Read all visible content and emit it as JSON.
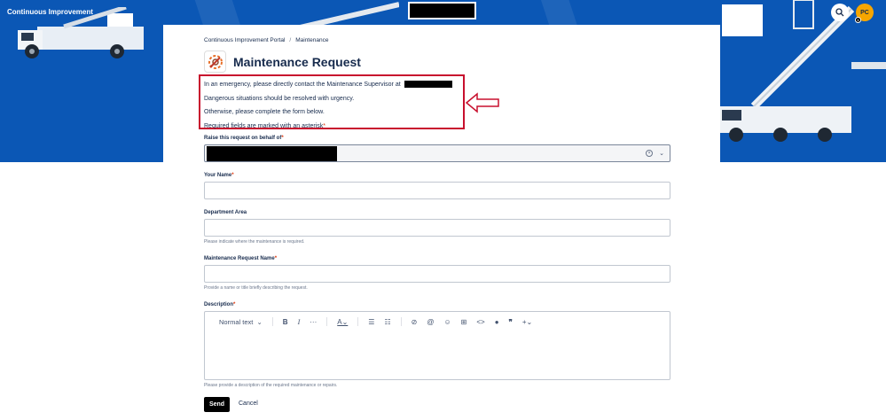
{
  "header": {
    "portal_title": "Continuous Improvement",
    "avatar_initials": "PC",
    "notification_count": "1"
  },
  "breadcrumb": {
    "items": [
      "Continuous Improvement Portal",
      "Maintenance"
    ],
    "separator": "/"
  },
  "page": {
    "title": "Maintenance Request",
    "icon": "wrench-gear-icon"
  },
  "notice": {
    "line1": "In an emergency, please directly contact the Maintenance Supervisor at",
    "line2": "Dangerous situations should be resolved with urgency.",
    "line3": "Otherwise, please complete the form below.",
    "line4": "Required fields are marked with an asterisk"
  },
  "form": {
    "required_marker": "*",
    "behalf": {
      "label": "Raise this request on behalf of"
    },
    "your_name": {
      "label": "Your Name",
      "value": ""
    },
    "department": {
      "label": "Department Area",
      "value": "",
      "help": "Please indicate where the maintenance is required."
    },
    "request_name": {
      "label": "Maintenance Request Name",
      "value": "",
      "help": "Provide a name or title briefly describing the request."
    },
    "description": {
      "label": "Description",
      "help": "Please provide a description of the required maintenance or repairs."
    }
  },
  "editor_toolbar": {
    "text_style": "Normal text",
    "tools": [
      "bold-icon",
      "italic-icon",
      "more-icon",
      "text-color-icon",
      "bullet-list-icon",
      "numbered-list-icon",
      "link-icon",
      "mention-icon",
      "emoji-icon",
      "table-icon",
      "code-icon",
      "info-icon",
      "quote-icon",
      "insert-icon"
    ]
  },
  "actions": {
    "send_label": "Send",
    "cancel_label": "Cancel"
  },
  "colors": {
    "hero_blue": "#0b57b5",
    "highlight_red": "#c8102e",
    "required_red": "#de350b",
    "avatar_orange": "#f7a600"
  }
}
